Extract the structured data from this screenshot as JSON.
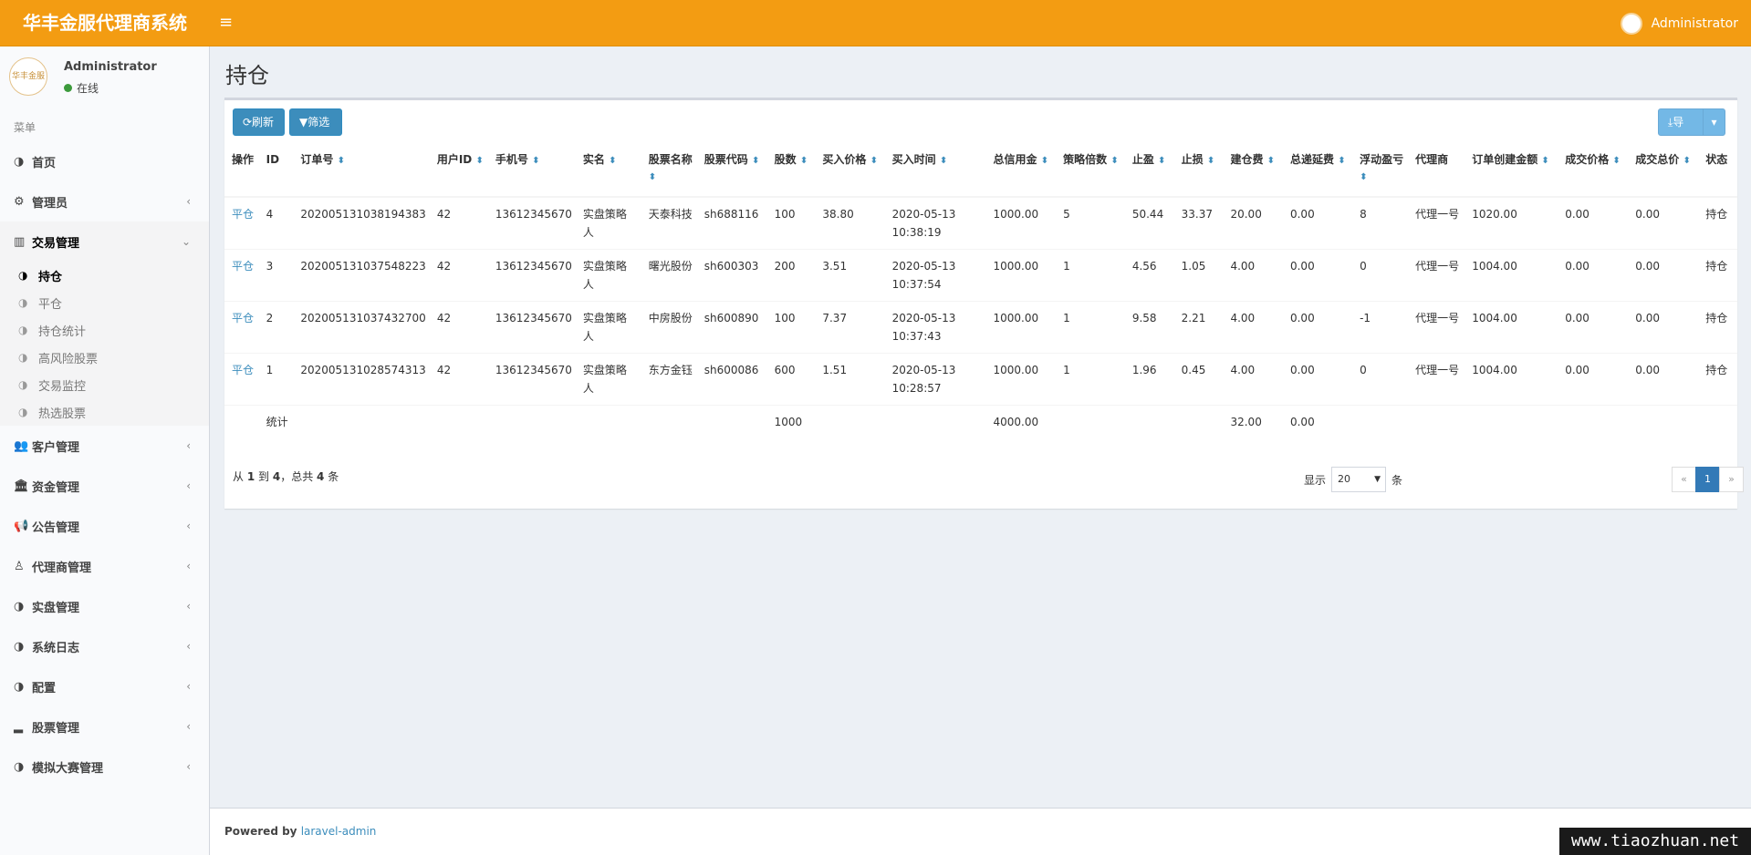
{
  "header": {
    "brand": "华丰金服代理商系统",
    "toggle": "≡",
    "user": "Administrator"
  },
  "sidebar": {
    "avatar_text": "华丰金服",
    "user_name": "Administrator",
    "status": "在线",
    "menu_header": "菜单",
    "items": [
      {
        "label": "首页",
        "icon": "◑"
      },
      {
        "label": "管理员",
        "icon": "⚙"
      },
      {
        "label": "交易管理",
        "icon": "▥"
      },
      {
        "label": "客户管理",
        "icon": "👥"
      },
      {
        "label": "资金管理",
        "icon": "🏛"
      },
      {
        "label": "公告管理",
        "icon": "📢"
      },
      {
        "label": "代理商管理",
        "icon": "♙"
      },
      {
        "label": "实盘管理",
        "icon": "◑"
      },
      {
        "label": "系统日志",
        "icon": "◑"
      },
      {
        "label": "配置",
        "icon": "◑"
      },
      {
        "label": "股票管理",
        "icon": "▂"
      },
      {
        "label": "模拟大赛管理",
        "icon": "◑"
      }
    ],
    "submenu": [
      "持仓",
      "平仓",
      "持仓统计",
      "高风险股票",
      "交易监控",
      "热选股票"
    ]
  },
  "page": {
    "title": "持仓"
  },
  "toolbar": {
    "refresh": "⟳刷新",
    "filter": "▼筛选",
    "export": "⤓导出",
    "caret": "▾"
  },
  "table": {
    "headers": [
      "操作",
      "ID",
      "订单号",
      "用户ID",
      "手机号",
      "实名",
      "股票名称",
      "股票代码",
      "股数",
      "买入价格",
      "买入时间",
      "总信用金",
      "策略倍数",
      "止盈",
      "止损",
      "建仓费",
      "总递延费",
      "浮动盈亏",
      "代理商",
      "订单创建金额",
      "成交价格",
      "成交总价",
      "状态"
    ],
    "rows": [
      [
        "平仓",
        "4",
        "202005131038194383",
        "42",
        "13612345670",
        "实盘策略人",
        "天泰科技",
        "sh688116",
        "100",
        "38.80",
        "2020-05-13 10:38:19",
        "1000.00",
        "5",
        "50.44",
        "33.37",
        "20.00",
        "0.00",
        "8",
        "代理一号",
        "1020.00",
        "0.00",
        "0.00",
        "持仓"
      ],
      [
        "平仓",
        "3",
        "202005131037548223",
        "42",
        "13612345670",
        "实盘策略人",
        "曙光股份",
        "sh600303",
        "200",
        "3.51",
        "2020-05-13 10:37:54",
        "1000.00",
        "1",
        "4.56",
        "1.05",
        "4.00",
        "0.00",
        "0",
        "代理一号",
        "1004.00",
        "0.00",
        "0.00",
        "持仓"
      ],
      [
        "平仓",
        "2",
        "202005131037432700",
        "42",
        "13612345670",
        "实盘策略人",
        "中房股份",
        "sh600890",
        "100",
        "7.37",
        "2020-05-13 10:37:43",
        "1000.00",
        "1",
        "9.58",
        "2.21",
        "4.00",
        "0.00",
        "-1",
        "代理一号",
        "1004.00",
        "0.00",
        "0.00",
        "持仓"
      ],
      [
        "平仓",
        "1",
        "202005131028574313",
        "42",
        "13612345670",
        "实盘策略人",
        "东方金钰",
        "sh600086",
        "600",
        "1.51",
        "2020-05-13 10:28:57",
        "1000.00",
        "1",
        "1.96",
        "0.45",
        "4.00",
        "0.00",
        "0",
        "代理一号",
        "1004.00",
        "0.00",
        "0.00",
        "持仓"
      ]
    ],
    "summary": [
      "",
      "统计",
      "",
      "",
      "",
      "",
      "",
      "",
      "1000",
      "",
      "",
      "4000.00",
      "",
      "",
      "",
      "32.00",
      "0.00",
      "",
      "",
      "",
      "",
      "",
      ""
    ]
  },
  "pagination": {
    "info_prefix": "从 ",
    "from": "1",
    "to_word": " 到 ",
    "to": "4",
    "total_prefix": "，总共 ",
    "total": "4",
    "total_suffix": " 条",
    "show_label": "显示",
    "per_page": "20",
    "unit": "条",
    "prev": "«",
    "page": "1",
    "next": "»"
  },
  "footer": {
    "prefix": "Powered by ",
    "link": "laravel-admin"
  },
  "watermark": "www.tiaozhuan.net"
}
